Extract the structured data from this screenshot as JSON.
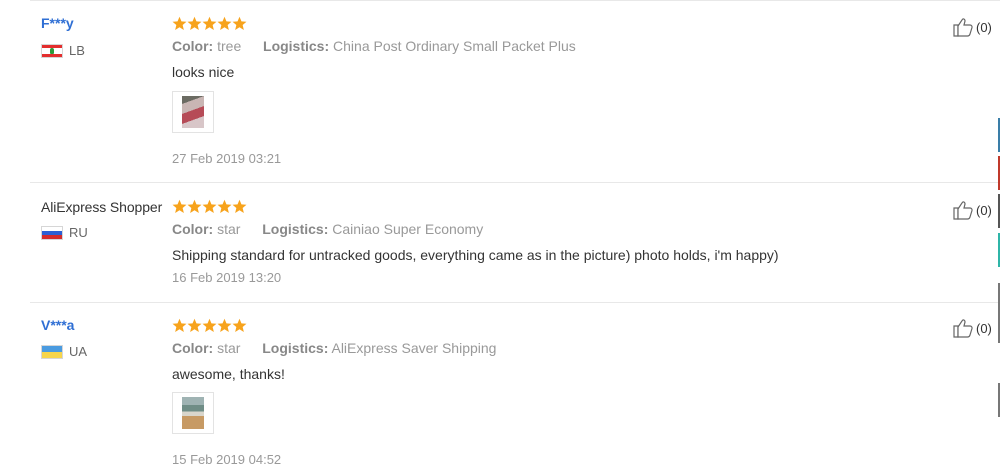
{
  "reviews": [
    {
      "name": "F***y",
      "country": "LB",
      "stars": 5,
      "color_label": "Color:",
      "color_value": "tree",
      "logistics_label": "Logistics:",
      "logistics_value": "China Post Ordinary Small Packet Plus",
      "text": "looks nice",
      "date": "27 Feb 2019 03:21",
      "likes": "(0)"
    },
    {
      "name": "AliExpress Shopper",
      "country": "RU",
      "stars": 5,
      "color_label": "Color:",
      "color_value": "star",
      "logistics_label": "Logistics:",
      "logistics_value": "Cainiao Super Economy",
      "text": "Shipping standard for untracked goods, everything came as in the picture) photo holds, i'm happy)",
      "date": "16 Feb 2019 13:20",
      "likes": "(0)"
    },
    {
      "name": "V***a",
      "country": "UA",
      "stars": 5,
      "color_label": "Color:",
      "color_value": "star",
      "logistics_label": "Logistics:",
      "logistics_value": "AliExpress Saver Shipping",
      "text": "awesome, thanks!",
      "date": "15 Feb 2019 04:52",
      "likes": "(0)"
    }
  ],
  "colors": {
    "star": "#f7a31c",
    "masked_name": "#2f6fd4",
    "meta_text": "#999999"
  },
  "icons": {
    "rating": "star-icon",
    "like": "thumbs-up-icon"
  }
}
